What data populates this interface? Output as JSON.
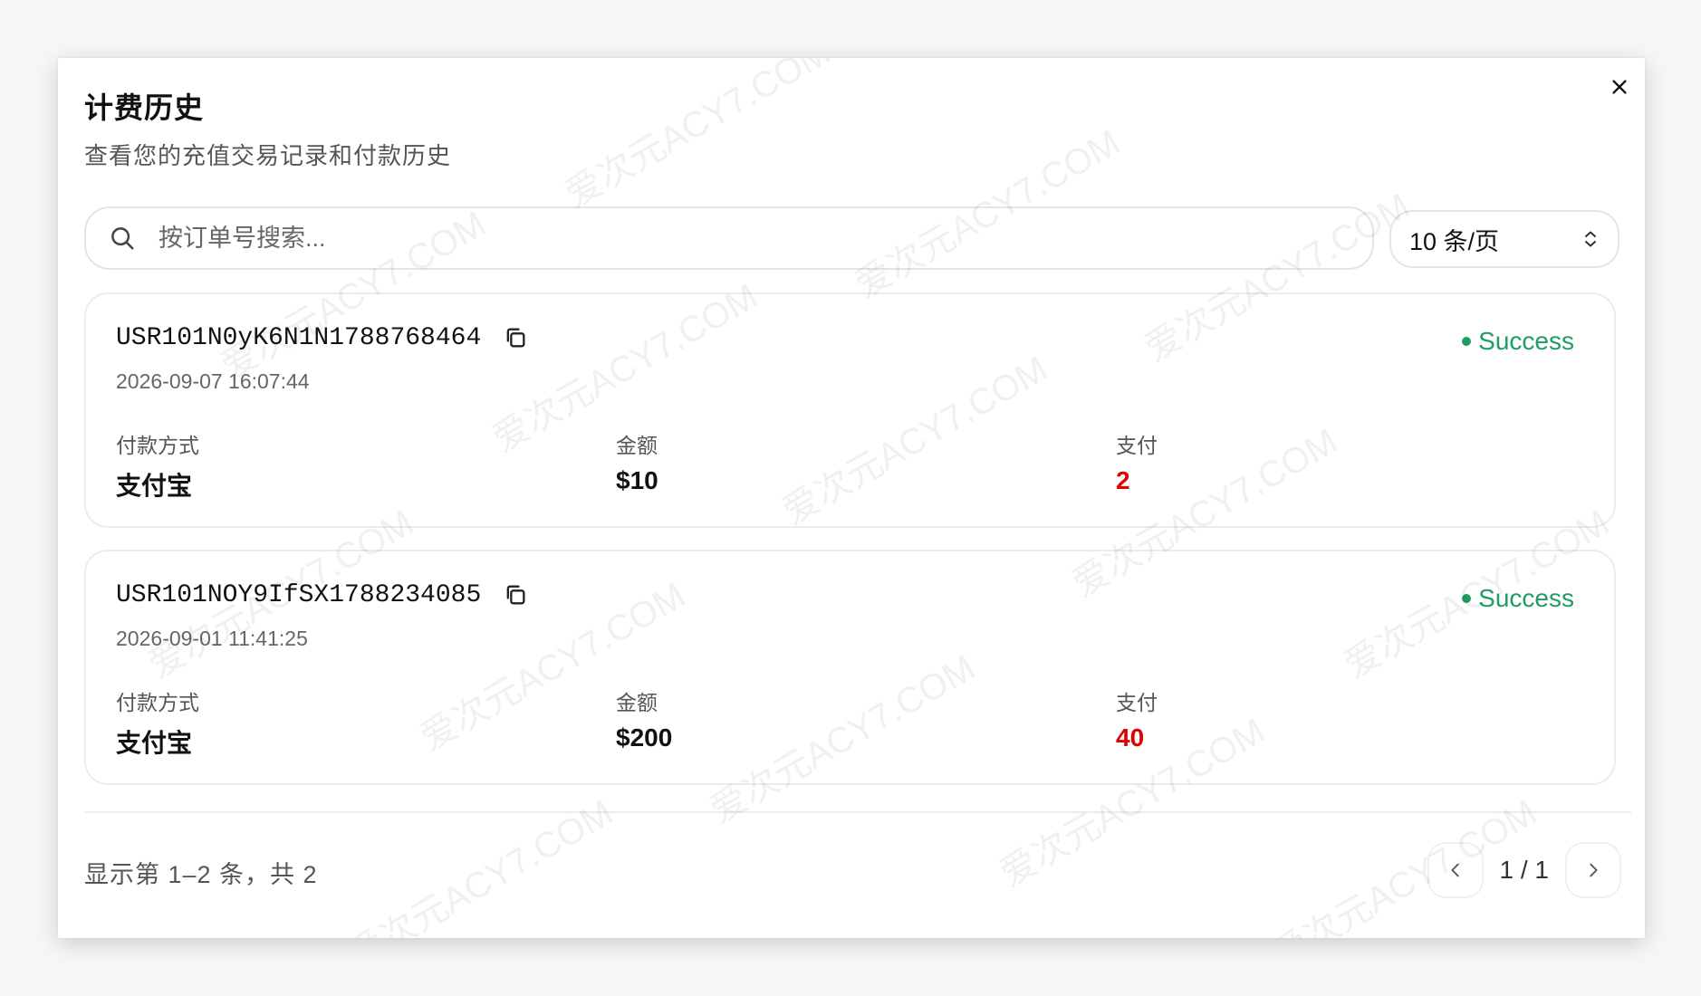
{
  "dialog": {
    "title": "计费历史",
    "subtitle": "查看您的充值交易记录和付款历史",
    "close_icon": "close-icon"
  },
  "search": {
    "placeholder": "按订单号搜索...",
    "value": "",
    "icon": "search-icon"
  },
  "page_size": {
    "value": "10 条/页"
  },
  "labels": {
    "payment_method": "付款方式",
    "amount": "金额",
    "paid": "支付"
  },
  "orders": [
    {
      "order_id": "USR101N0yK6N1N1788768464",
      "time": "2026-09-07 16:07:44",
      "status": "Success",
      "payment_method": "支付宝",
      "amount": "$10",
      "paid": "2"
    },
    {
      "order_id": "USR101NOY9IfSX1788234085",
      "time": "2026-09-01 11:41:25",
      "status": "Success",
      "payment_method": "支付宝",
      "amount": "$200",
      "paid": "40"
    }
  ],
  "footer": {
    "summary": "显示第 1–2 条，共 2",
    "page_indicator": "1 / 1"
  },
  "watermark": "爱次元ACY7.COM",
  "colors": {
    "success": "#1f9d63",
    "paid": "#e00000",
    "border": "#ececef"
  }
}
